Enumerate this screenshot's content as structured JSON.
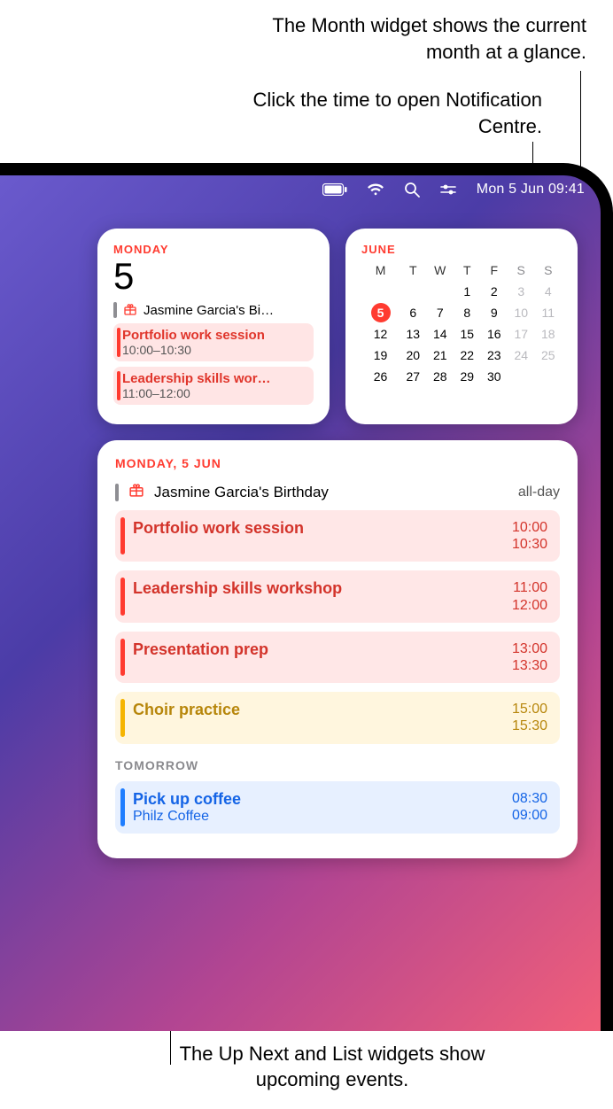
{
  "callouts": {
    "month": "The Month widget shows the current month at a glance.",
    "time": "Click the time to open Notification Centre.",
    "list": "The Up Next and List widgets show upcoming events."
  },
  "menubar": {
    "clock": "Mon 5 Jun 09:41",
    "icons": {
      "battery": "battery-icon",
      "wifi": "wifi-icon",
      "search": "search-icon",
      "control": "control-centre-icon"
    }
  },
  "upnext": {
    "dayOfWeek": "Monday",
    "dayNumber": "5",
    "birthday": "Jasmine Garcia's Bi…",
    "events": [
      {
        "title": "Portfolio work session",
        "time": "10:00–10:30"
      },
      {
        "title": "Leadership skills wor…",
        "time": "11:00–12:00"
      }
    ]
  },
  "month": {
    "title": "June",
    "weekdays": [
      "M",
      "T",
      "W",
      "T",
      "F",
      "S",
      "S"
    ],
    "weeks": [
      [
        null,
        null,
        null,
        "1",
        "2",
        "3",
        "4"
      ],
      [
        "5",
        "6",
        "7",
        "8",
        "9",
        "10",
        "11"
      ],
      [
        "12",
        "13",
        "14",
        "15",
        "16",
        "17",
        "18"
      ],
      [
        "19",
        "20",
        "21",
        "22",
        "23",
        "24",
        "25"
      ],
      [
        "26",
        "27",
        "28",
        "29",
        "30",
        null,
        null
      ]
    ],
    "todayIndex": [
      1,
      0
    ]
  },
  "list": {
    "heading": "Monday, 5 Jun",
    "birthday": {
      "title": "Jasmine Garcia's Birthday",
      "right": "all-day"
    },
    "today": [
      {
        "title": "Portfolio work session",
        "start": "10:00",
        "end": "10:30",
        "color": "red"
      },
      {
        "title": "Leadership skills workshop",
        "start": "11:00",
        "end": "12:00",
        "color": "red"
      },
      {
        "title": "Presentation prep",
        "start": "13:00",
        "end": "13:30",
        "color": "red"
      },
      {
        "title": "Choir practice",
        "start": "15:00",
        "end": "15:30",
        "color": "yellow"
      }
    ],
    "tomorrowHeading": "Tomorrow",
    "tomorrow": [
      {
        "title": "Pick up coffee",
        "sub": "Philz Coffee",
        "start": "08:30",
        "end": "09:00",
        "color": "blue"
      }
    ]
  }
}
